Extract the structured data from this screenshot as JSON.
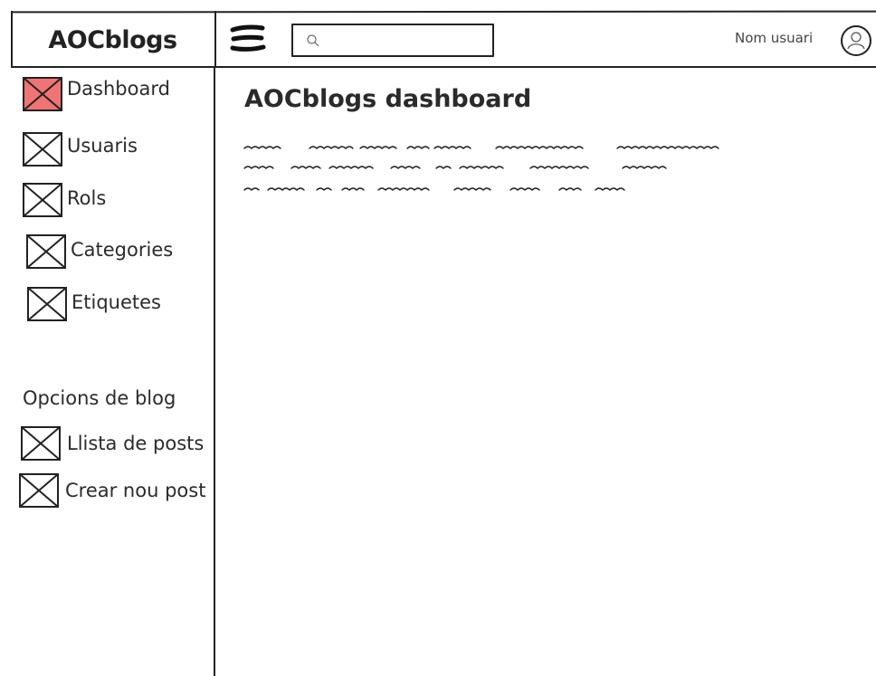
{
  "app": {
    "logo": "AOCblogs"
  },
  "header": {
    "search_placeholder": "",
    "user_name": "Nom usuari"
  },
  "sidebar": {
    "items": [
      {
        "label": "Dashboard",
        "active": true
      },
      {
        "label": "Usuaris",
        "active": false
      },
      {
        "label": "Rols",
        "active": false
      },
      {
        "label": "Categories",
        "active": false
      },
      {
        "label": "Etiquetes",
        "active": false
      }
    ],
    "blog_section": {
      "title": "Opcions de blog",
      "items": [
        {
          "label": "Llista de posts"
        },
        {
          "label": "Crear nou post"
        }
      ]
    }
  },
  "main": {
    "title": "AOCblogs dashboard"
  },
  "colors": {
    "active_placeholder_fill": "#f07474",
    "stroke": "#222222"
  },
  "icons": {
    "menu": "hamburger-icon",
    "search": "search-icon",
    "user": "user-avatar-icon",
    "placeholder": "image-placeholder-icon"
  }
}
